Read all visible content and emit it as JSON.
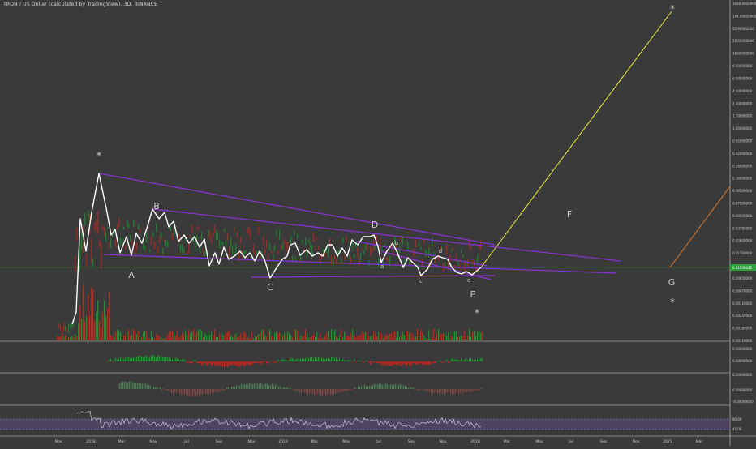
{
  "symbol_title": "TRON / US Dollar (calculated by TradingView), 3D, BINANCE",
  "colors": {
    "background": "#3a3a3a",
    "price_line": "#ffffff",
    "channel": "#8a34d8",
    "projection_yellow": "#e6ee3a",
    "projection_orange": "#e07a2a",
    "up_candle": "#2e9e3e",
    "down_candle": "#c0352b",
    "last_price_badge": "#2e9e3e",
    "rsi_band": "#5b4a7a",
    "rsi_line": "#c8c8d8",
    "axis_text": "#cfcfcf",
    "wave_label": "#cfcfcf"
  },
  "chart_data": {
    "type": "line",
    "scale": "log",
    "price_axis_ticks": [
      "1600.00000000",
      "104.00000000",
      "52.00000000",
      "26.00000000",
      "16.00000000",
      "9.00000000",
      "6.50000000",
      "4.00000000",
      "2.40000000",
      "1.70000000",
      "1.00000000",
      "0.65000000",
      "0.42000000",
      "0.26000000",
      "0.16000000",
      "0.10500000",
      "0.07500000",
      "0.05000000",
      "0.03700000",
      "0.02600000",
      "0.01700000",
      "0.01050000",
      "0.00650000",
      "0.00470000",
      "0.00320000",
      "0.00250000",
      "0.00160000",
      "0.00110000"
    ],
    "time_axis_ticks": [
      "Nov",
      "2018",
      "Mar",
      "May",
      "Jul",
      "Sep",
      "Nov",
      "2019",
      "Mar",
      "May",
      "Jul",
      "Sep",
      "Nov",
      "2020",
      "Mar",
      "May",
      "Jul",
      "Sep",
      "Nov",
      "2021",
      "Mar"
    ],
    "last_price": "0.01530045",
    "wave_labels": [
      "*",
      "A",
      "B",
      "C",
      "D",
      "a",
      "b",
      "c",
      "d",
      "e",
      "E",
      "*",
      "F",
      "G",
      "*",
      "*"
    ],
    "osc1_ticks": [
      "0.50000000",
      "0.00000000"
    ],
    "osc2_ticks": [
      "0.20000000",
      "0.00000000",
      "-0.20000000"
    ],
    "rsi_ticks": [
      "80.00",
      "45.00"
    ]
  }
}
